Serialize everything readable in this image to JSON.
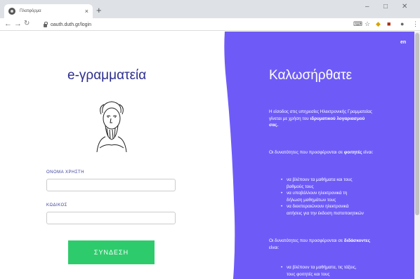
{
  "browser": {
    "tab_title": "Πλατφόρμα",
    "url": "oauth.duth.gr/login"
  },
  "colors": {
    "purple": "#6e5bf7",
    "green": "#2ecb6c",
    "title_blue": "#2b2d8f"
  },
  "icons": [
    "back-arrow-icon",
    "forward-arrow-icon",
    "reload-icon",
    "lock-icon",
    "translate-icon",
    "star-icon",
    "extension-icon",
    "profile-icon",
    "menu-icon"
  ],
  "login": {
    "title": "e-γραμματεία",
    "username_label": "ΟΝΟΜΑ ΧΡΗΣΤΗ",
    "username_value": "",
    "password_label": "ΚΩΔΙΚΟΣ",
    "password_value": "",
    "submit_label": "ΣΥΝΔΕΣΗ"
  },
  "welcome": {
    "lang": "en",
    "title": "Καλωσήρθατε",
    "intro_pre": "Η είσοδος στις υπηρεσίες Ηλεκτρονικής Γραμματείας γίνεται με χρήση του",
    "intro_bold": "ιδρυματικού λογαριασμού σας.",
    "students_pre": "Οι δυνατότητες που προσφέρονται σε",
    "students_bold": "φοιτητές",
    "students_post": "είναι:",
    "student_items": [
      "να βλέπουν τα μαθήματα και τους βαθμούς τους",
      "να υποβάλλουν ηλεκτρονικά τη δήλωση μαθημάτων τους",
      "να διεκπεραιώνουν ηλεκτρονικά αιτήσεις για την έκδοση πιστοποιητικών"
    ],
    "teachers_pre": "Οι δυνατότητες που προσφέρονται σε",
    "teachers_bold": "διδάσκοντες",
    "teachers_post": "είναι:",
    "teacher_items": [
      "να βλέπουν τα μαθήματα, τις τάξεις, τους φοιτητές και τους"
    ]
  }
}
